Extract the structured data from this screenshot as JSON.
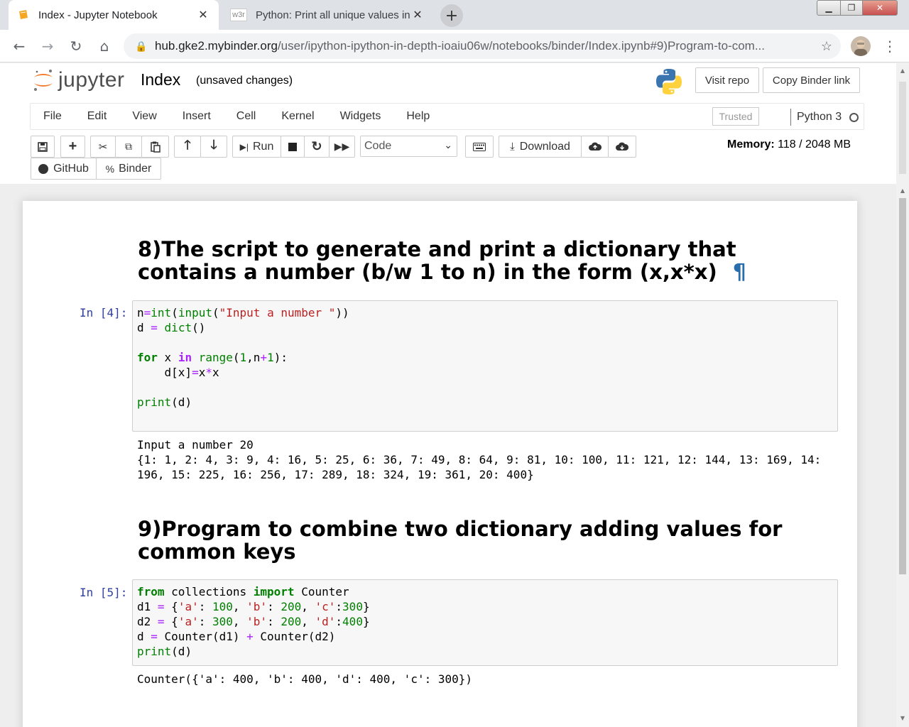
{
  "browser": {
    "tabs": [
      {
        "title": "Index - Jupyter Notebook",
        "active": true
      },
      {
        "title": "Python: Print all unique values in",
        "favicon_text": "w3r",
        "active": false
      }
    ],
    "url_host": "hub.gke2.mybinder.org",
    "url_path": "/user/ipython-ipython-in-depth-ioaiu06w/notebooks/binder/Index.ipynb#9)Program-to-com..."
  },
  "jupyter": {
    "logo_text": "jupyter",
    "notebook_name": "Index",
    "save_state": "(unsaved changes)",
    "visit_repo": "Visit repo",
    "copy_binder_link": "Copy Binder link",
    "menu": [
      "File",
      "Edit",
      "View",
      "Insert",
      "Cell",
      "Kernel",
      "Widgets",
      "Help"
    ],
    "trusted": "Trusted",
    "kernel": "Python 3",
    "toolbar": {
      "run": "Run",
      "cell_type": "Code",
      "download": "Download",
      "github": "GitHub",
      "binder": "Binder"
    },
    "memory_label": "Memory:",
    "memory_value": "118 / 2048 MB"
  },
  "cells": {
    "heading8": "8)The script to generate and print a dictionary that contains a number (b/w 1 to n) in the form (x,x*x)",
    "pilcrow": "¶",
    "prompt4": "In [4]:",
    "output4_line1": "Input a number 20",
    "output4_line2": "{1: 1, 2: 4, 3: 9, 4: 16, 5: 25, 6: 36, 7: 49, 8: 64, 9: 81, 10: 100, 11: 121, 12: 144, 13: 169, 14: 196, 15: 225, 16: 256, 17: 289, 18: 324, 19: 361, 20: 400}",
    "heading9": "9)Program to combine two dictionary adding values for common keys",
    "prompt5": "In [5]:",
    "output5": "Counter({'a': 400, 'b': 400, 'd': 400, 'c': 300})"
  }
}
